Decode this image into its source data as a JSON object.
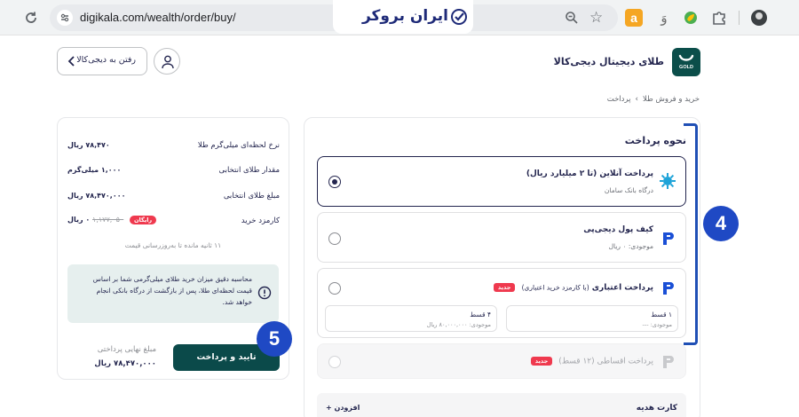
{
  "browser": {
    "url": "digikala.com/wealth/order/buy/",
    "brand_text": "ایران بروکر",
    "ext_a": "a",
    "ext_fa": "وَ"
  },
  "header": {
    "back_label": "رفتن به دیجی‌کالا",
    "page_title": "طلای دیجیتال دیجی‌کالا",
    "logo_text": "GOLD"
  },
  "breadcrumb": [
    "خرید و فروش طلا",
    "›",
    "پرداخت"
  ],
  "payment": {
    "section_title": "نحوه پرداخت",
    "options": [
      {
        "title": "پرداخت آنلاین (تا ۲ میلیارد ریال)",
        "subtitle": "درگاه بانک سامان",
        "selected": true
      },
      {
        "title": "کیف پول دیجی‌پی",
        "subtitle": "موجودی: ۰ ریال",
        "selected": false
      },
      {
        "title": "پرداخت اعتباری",
        "title_extra": "(با کارمزد خرید اعتباری)",
        "badge": "جدید",
        "selected": false,
        "installments": [
          {
            "label": "۱ قسط",
            "value": "موجودی: ---"
          },
          {
            "label": "۴ قسط",
            "value": "موجودی: ۸۰,۰۰۰,۰۰۰ ریال"
          }
        ]
      },
      {
        "title": "پرداخت اقساطی (۱۲ قسط)",
        "badge": "جدید",
        "selected": false,
        "disabled": true
      }
    ],
    "gift_title": "کارت هدیه",
    "gift_add": "افزودن +"
  },
  "summary": {
    "rows": [
      {
        "label": "نرخ لحظه‌ای میلی‌گرم طلا",
        "value": "۷۸,۴۷۰ ریال"
      },
      {
        "label": "مقدار طلای انتخابی",
        "value": "۱,۰۰۰ میلی‌گرم"
      },
      {
        "label": "مبلغ طلای انتخابی",
        "value": "۷۸,۴۷۰,۰۰۰ ریال"
      }
    ],
    "fee_label": "کارمزد خرید",
    "fee_old": "۱,۱۷۷,۰۵۰",
    "fee_new": "۰ ریال",
    "fee_badge": "رایگان",
    "timer": "۱۱ ثانیه مانده تا به‌روزرسانی قیمت",
    "info": "محاسبه دقیق میزان خرید طلای میلی‌گرمی شما بر اساس قیمت لحظه‌ای طلا، پس از بازگشت از درگاه بانکی انجام خواهد شد.",
    "confirm": "تایید و پرداخت",
    "final_label": "مبلغ نهایی پرداختی",
    "final_value": "۷۸,۴۷۰,۰۰۰ ریال"
  },
  "annotations": {
    "step4": "4",
    "step5": "5"
  },
  "colors": {
    "primary": "#0b4a4a",
    "accent_red": "#ef394e",
    "annot_blue": "#1f49c4",
    "text": "#23254e"
  }
}
